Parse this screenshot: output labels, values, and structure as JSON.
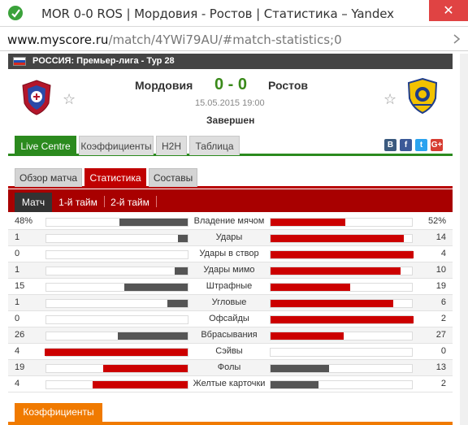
{
  "window": {
    "title": "MOR 0-0 ROS | Мордовия - Ростов | Статистика – Yandex",
    "close_glyph": "✕"
  },
  "address": {
    "host": "www.myscore.ru",
    "path": "/match/4YWi79AU/#match-statistics;0"
  },
  "league": {
    "name": "РОССИЯ: Премьер-лига - Тур 28"
  },
  "match": {
    "home_team": "Мордовия",
    "away_team": "Ростов",
    "score": "0 - 0",
    "datetime": "15.05.2015 19:00",
    "status": "Завершен",
    "favorite_glyph": "☆"
  },
  "main_tabs": [
    {
      "label": "Live Centre",
      "active": true
    },
    {
      "label": "Коэффициенты",
      "active": false
    },
    {
      "label": "H2H",
      "active": false
    },
    {
      "label": "Таблица",
      "active": false
    }
  ],
  "share_buttons": [
    {
      "label": "B",
      "icon": "vk-icon",
      "color": "#3b5a7e"
    },
    {
      "label": "f",
      "icon": "facebook-icon",
      "color": "#3b5998"
    },
    {
      "label": "t",
      "icon": "twitter-icon",
      "color": "#2aa3ef"
    },
    {
      "label": "G+",
      "icon": "googleplus-icon",
      "color": "#d73d32"
    }
  ],
  "sub_tabs": [
    {
      "label": "Обзор матча",
      "active": false
    },
    {
      "label": "Статистика",
      "active": true
    },
    {
      "label": "Составы",
      "active": false
    }
  ],
  "period_tabs": [
    {
      "label": "Матч",
      "active": true
    },
    {
      "label": "1-й тайм",
      "active": false
    },
    {
      "label": "2-й тайм",
      "active": false
    }
  ],
  "colors": {
    "home_bar": "#555555",
    "away_bar": "#cc0000",
    "highlight_bar": "#cc0000",
    "muted_bar": "#555555"
  },
  "stats": [
    {
      "label": "Владение мячом",
      "home": "48%",
      "away": "52%",
      "home_val": 48,
      "away_val": 52
    },
    {
      "label": "Удары",
      "home": "1",
      "away": "14",
      "home_val": 1,
      "away_val": 14
    },
    {
      "label": "Удары в створ",
      "home": "0",
      "away": "4",
      "home_val": 0,
      "away_val": 4
    },
    {
      "label": "Удары мимо",
      "home": "1",
      "away": "10",
      "home_val": 1,
      "away_val": 10
    },
    {
      "label": "Штрафные",
      "home": "15",
      "away": "19",
      "home_val": 15,
      "away_val": 19
    },
    {
      "label": "Угловые",
      "home": "1",
      "away": "6",
      "home_val": 1,
      "away_val": 6
    },
    {
      "label": "Офсайды",
      "home": "0",
      "away": "2",
      "home_val": 0,
      "away_val": 2
    },
    {
      "label": "Вбрасывания",
      "home": "26",
      "away": "27",
      "home_val": 26,
      "away_val": 27
    },
    {
      "label": "Сэйвы",
      "home": "4",
      "away": "0",
      "home_val": 4,
      "away_val": 0
    },
    {
      "label": "Фолы",
      "home": "19",
      "away": "13",
      "home_val": 19,
      "away_val": 13
    },
    {
      "label": "Желтые карточки",
      "home": "4",
      "away": "2",
      "home_val": 4,
      "away_val": 2
    }
  ],
  "odds_section": {
    "tab_label": "Коэффициенты"
  }
}
